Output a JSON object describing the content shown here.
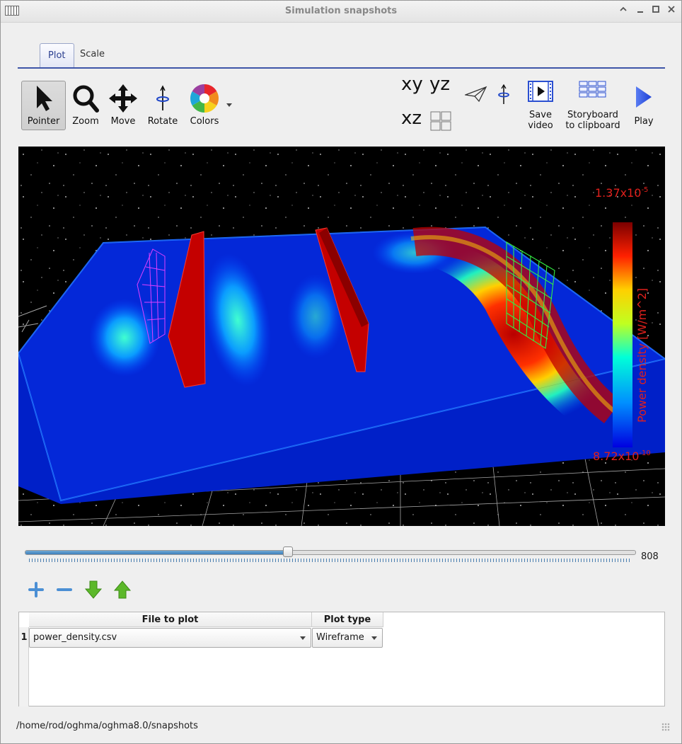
{
  "window": {
    "title": "Simulation snapshots"
  },
  "tabs": [
    {
      "label": "Plot"
    },
    {
      "label": "Scale"
    }
  ],
  "toolbar": {
    "pointer": "Pointer",
    "zoom": "Zoom",
    "move": "Move",
    "rotate": "Rotate",
    "colors": "Colors",
    "view_xy": "xy",
    "view_yz": "yz",
    "view_xz": "xz",
    "save_video": [
      "Save",
      "video"
    ],
    "storyboard": [
      "Storyboard",
      "to clipboard"
    ],
    "play": "Play"
  },
  "plot": {
    "colorbar_max": "1.37x10",
    "colorbar_max_exp": "-5",
    "colorbar_min": "8.72x10",
    "colorbar_min_exp": "-10",
    "colorbar_label": "Power density [W/m^2]",
    "colors": {
      "background": "#000000",
      "label": "#e0201c"
    }
  },
  "slider": {
    "value": "808",
    "fraction": 0.43
  },
  "table": {
    "headers": [
      "File to plot",
      "Plot type"
    ],
    "rows": [
      {
        "num": "1",
        "file": "power_density.csv",
        "type": "Wireframe"
      }
    ]
  },
  "status": {
    "path": "/home/rod/oghma/oghma8.0/snapshots"
  }
}
